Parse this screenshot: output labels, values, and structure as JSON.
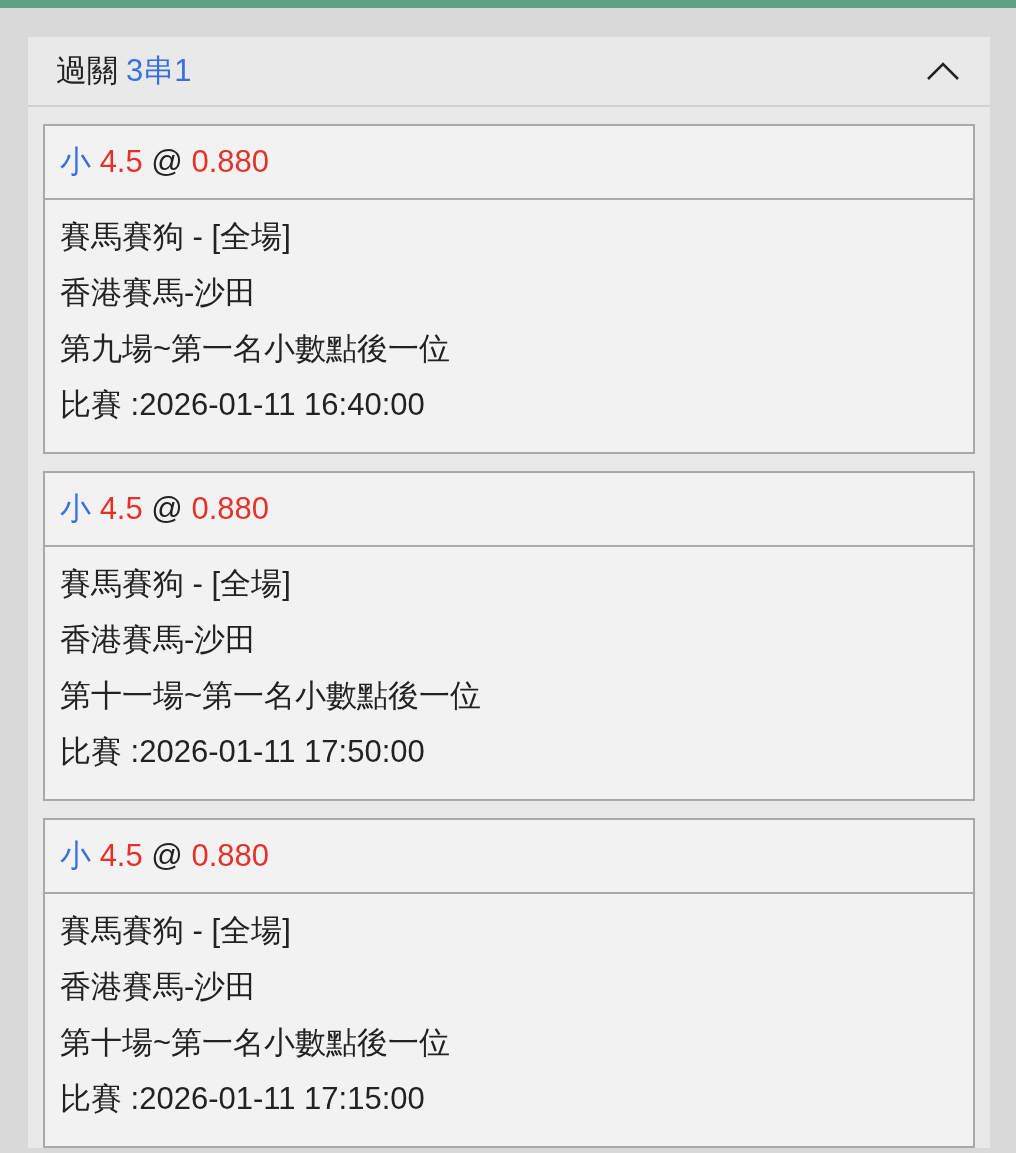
{
  "panel": {
    "title": "過關",
    "combo": "3串1",
    "expanded": true
  },
  "bets": [
    {
      "selection": "小",
      "line": "4.5",
      "at": "@",
      "odds": "0.880",
      "details": [
        "賽馬賽狗 - [全場]",
        "香港賽馬-沙田",
        "第九場~第一名小數點後一位",
        "比賽 :2026-01-11 16:40:00"
      ]
    },
    {
      "selection": "小",
      "line": "4.5",
      "at": "@",
      "odds": "0.880",
      "details": [
        "賽馬賽狗 - [全場]",
        "香港賽馬-沙田",
        "第十一場~第一名小數點後一位",
        "比賽 :2026-01-11 17:50:00"
      ]
    },
    {
      "selection": "小",
      "line": "4.5",
      "at": "@",
      "odds": "0.880",
      "details": [
        "賽馬賽狗 - [全場]",
        "香港賽馬-沙田",
        "第十場~第一名小數點後一位",
        "比賽 :2026-01-11 17:15:00"
      ]
    }
  ]
}
